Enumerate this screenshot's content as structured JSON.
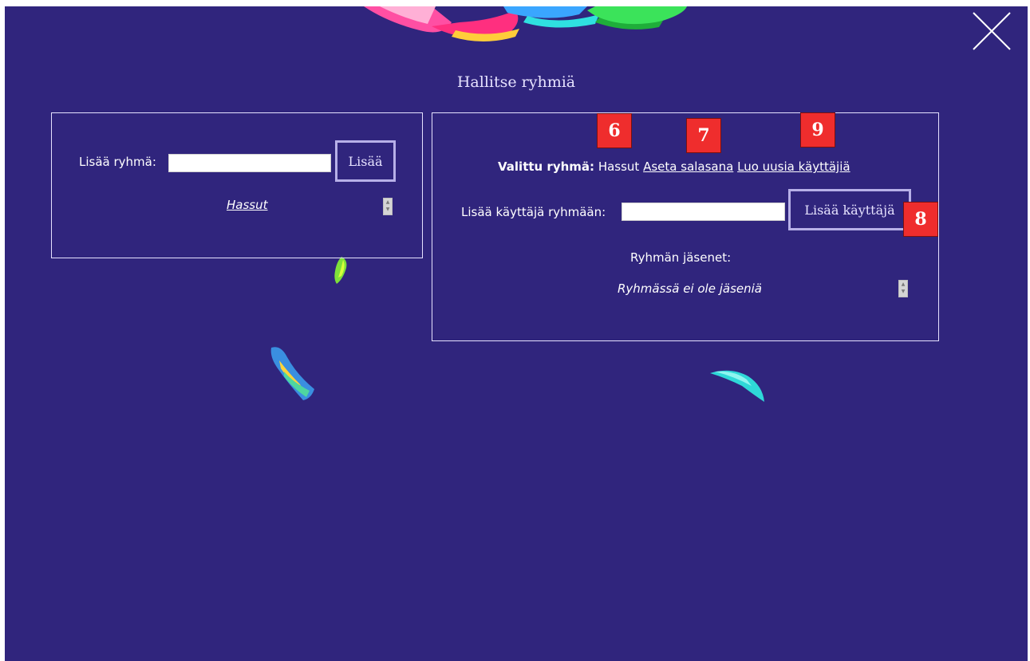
{
  "colors": {
    "background": "#30257d",
    "badge": "#ef2d2d",
    "accent_border": "#b7b0e8",
    "title": "#e6e2ff"
  },
  "title": "Hallitse ryhmiä",
  "close_icon": "close-x-icon",
  "left_panel": {
    "add_group_label": "Lisää ryhmä:",
    "add_group_input_value": "",
    "add_button_label": "Lisää",
    "groups": [
      "Hassut"
    ]
  },
  "right_panel": {
    "selected_group_label": "Valittu ryhmä:",
    "selected_group_name": "Hassut",
    "set_password_link": "Aseta salasana",
    "create_users_link": "Luo uusia käyttäjiä",
    "add_user_label": "Lisää käyttäjä ryhmään:",
    "add_user_input_value": "",
    "add_user_button_label": "Lisää käyttäjä",
    "members_heading": "Ryhmän jäsenet:",
    "members_empty_text": "Ryhmässä ei ole jäseniä"
  },
  "badges": [
    "6",
    "7",
    "8",
    "9"
  ]
}
